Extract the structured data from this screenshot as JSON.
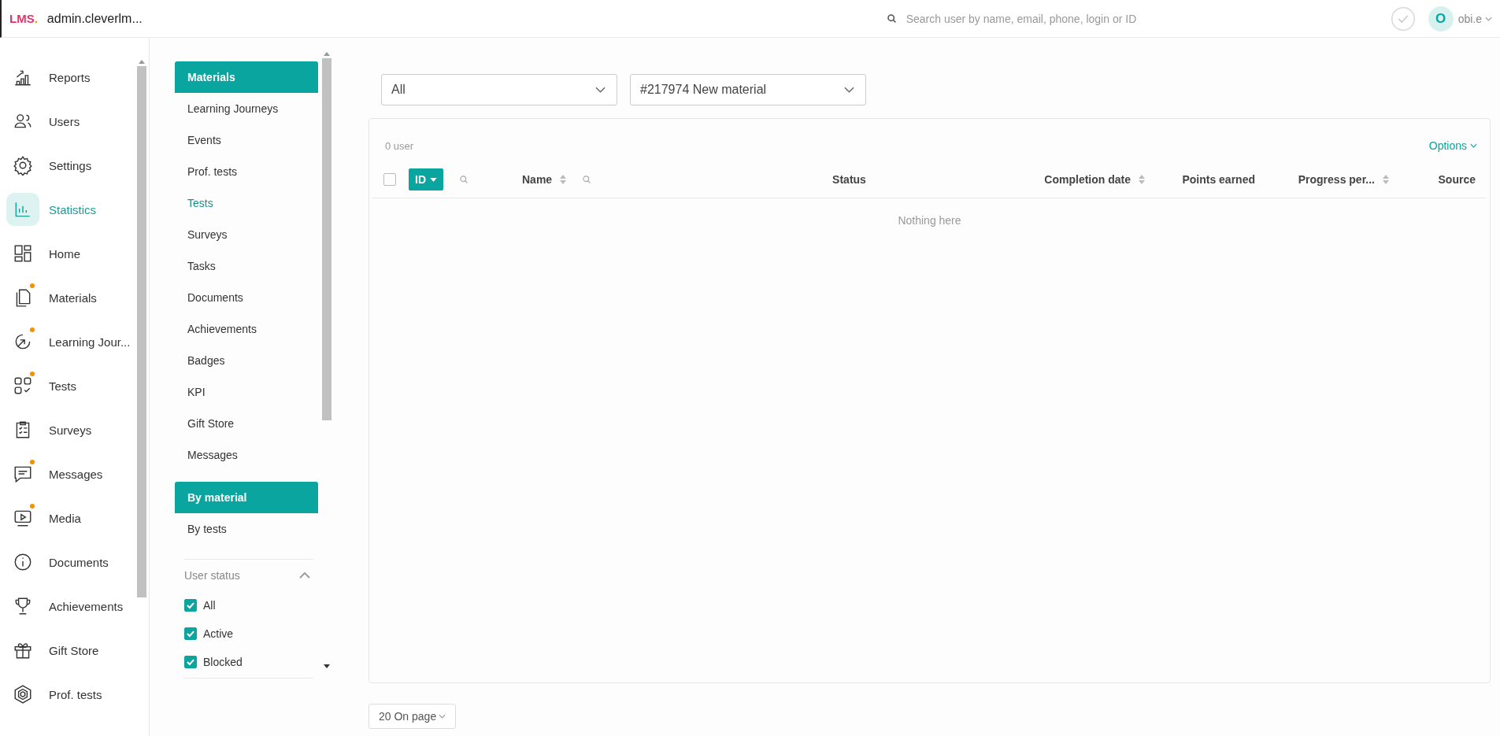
{
  "header": {
    "logo": "LMS",
    "logo_dot": ".",
    "site": "admin.cleverlm...",
    "search": {
      "placeholder": "Search user by name, email, phone, login or ID"
    },
    "avatar": "O",
    "user": "obi.e"
  },
  "sidebar": {
    "items": [
      {
        "label": "Reports",
        "selected": false,
        "dot": false
      },
      {
        "label": "Users",
        "selected": false,
        "dot": false
      },
      {
        "label": "Settings",
        "selected": false,
        "dot": false
      },
      {
        "label": "Statistics",
        "selected": true,
        "dot": false
      },
      {
        "label": "Home",
        "selected": false,
        "dot": false
      },
      {
        "label": "Materials",
        "selected": false,
        "dot": true
      },
      {
        "label": "Learning Jour...",
        "selected": false,
        "dot": true
      },
      {
        "label": "Tests",
        "selected": false,
        "dot": true
      },
      {
        "label": "Surveys",
        "selected": false,
        "dot": false
      },
      {
        "label": "Messages",
        "selected": false,
        "dot": true
      },
      {
        "label": "Media",
        "selected": false,
        "dot": true
      },
      {
        "label": "Documents",
        "selected": false,
        "dot": false
      },
      {
        "label": "Achievements",
        "selected": false,
        "dot": false
      },
      {
        "label": "Gift Store",
        "selected": false,
        "dot": false
      },
      {
        "label": "Prof. tests",
        "selected": false,
        "dot": false
      }
    ]
  },
  "submenu": {
    "items": [
      {
        "label": "Materials",
        "selected": true,
        "hovered": false
      },
      {
        "label": "Learning Journeys",
        "selected": false,
        "hovered": false
      },
      {
        "label": "Events",
        "selected": false,
        "hovered": false
      },
      {
        "label": "Prof. tests",
        "selected": false,
        "hovered": false
      },
      {
        "label": "Tests",
        "selected": false,
        "hovered": true
      },
      {
        "label": "Surveys",
        "selected": false,
        "hovered": false
      },
      {
        "label": "Tasks",
        "selected": false,
        "hovered": false
      },
      {
        "label": "Documents",
        "selected": false,
        "hovered": false
      },
      {
        "label": "Achievements",
        "selected": false,
        "hovered": false
      },
      {
        "label": "Badges",
        "selected": false,
        "hovered": false
      },
      {
        "label": "KPI",
        "selected": false,
        "hovered": false
      },
      {
        "label": "Gift Store",
        "selected": false,
        "hovered": false
      },
      {
        "label": "Messages",
        "selected": false,
        "hovered": false
      }
    ],
    "views": [
      {
        "label": "By material",
        "selected": true
      },
      {
        "label": "By tests",
        "selected": false
      }
    ],
    "user_status": {
      "title": "User status",
      "expanded": true,
      "options": [
        {
          "label": "All",
          "checked": true
        },
        {
          "label": "Active",
          "checked": true
        },
        {
          "label": "Blocked",
          "checked": true
        }
      ]
    }
  },
  "filters": [
    {
      "value": "All"
    },
    {
      "value": "#217974 New material"
    }
  ],
  "table": {
    "count": "0 user",
    "options": "Options",
    "select_all": {
      "checked": false
    },
    "columns": [
      {
        "label": "ID",
        "sortable": false,
        "searchable": true,
        "active": true
      },
      {
        "label": "Name",
        "sortable": true,
        "searchable": true,
        "active": false
      },
      {
        "label": "Status",
        "sortable": false,
        "searchable": false,
        "active": false
      },
      {
        "label": "Completion date",
        "sortable": true,
        "searchable": false,
        "active": false
      },
      {
        "label": "Points earned",
        "sortable": false,
        "searchable": false,
        "active": false
      },
      {
        "label": "Progress per...",
        "sortable": true,
        "searchable": false,
        "active": false
      },
      {
        "label": "Source",
        "sortable": false,
        "searchable": false,
        "active": false
      }
    ],
    "empty": "Nothing here"
  },
  "pagination": {
    "per_page": "20 On page"
  }
}
